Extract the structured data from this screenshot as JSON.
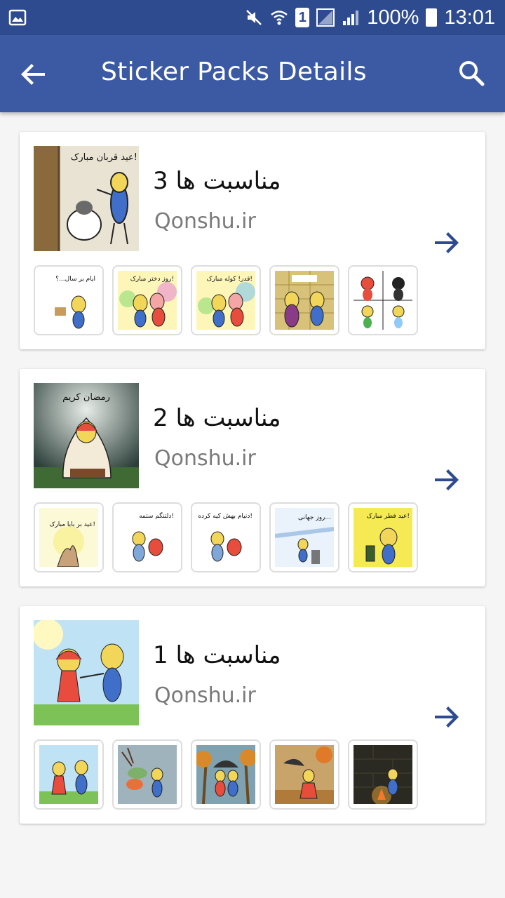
{
  "status_bar": {
    "battery_text": "100%",
    "time": "13:01",
    "sim_label": "1",
    "icons": [
      "gallery-icon",
      "mute-icon",
      "wifi-icon",
      "sim-icon",
      "signal-icon",
      "signal-icon",
      "battery-icon"
    ]
  },
  "app_bar": {
    "title": "Sticker Packs Details",
    "back_icon": "arrow-back-icon",
    "search_icon": "search-icon",
    "color": "#3b5aa3"
  },
  "packs": [
    {
      "name": "مناسبت ها 3",
      "publisher": "Qonshu.ir",
      "cover_caption": "عید قربان مبارک!",
      "stickers": [
        {
          "caption": "ایام بر سال...؟"
        },
        {
          "caption": "روز دختر مبارک!"
        },
        {
          "caption": "قدر! کوله مبارک!"
        },
        {
          "caption": ""
        },
        {
          "caption": ""
        }
      ]
    },
    {
      "name": "مناسبت ها 2",
      "publisher": "Qonshu.ir",
      "cover_caption": "رمضان کریم",
      "stickers": [
        {
          "caption": "عید بر بابا مبارک!"
        },
        {
          "caption": "دلتنگم ستمه!"
        },
        {
          "caption": "دنیام بهش کیه کرده!"
        },
        {
          "caption": "روز جهانی..."
        },
        {
          "caption": "عید فطر مبارک!"
        }
      ]
    },
    {
      "name": "مناسبت ها 1",
      "publisher": "Qonshu.ir",
      "cover_caption": "",
      "stickers": [
        {
          "caption": ""
        },
        {
          "caption": ""
        },
        {
          "caption": ""
        },
        {
          "caption": ""
        },
        {
          "caption": ""
        }
      ]
    }
  ],
  "accent_color": "#2d4b8e"
}
